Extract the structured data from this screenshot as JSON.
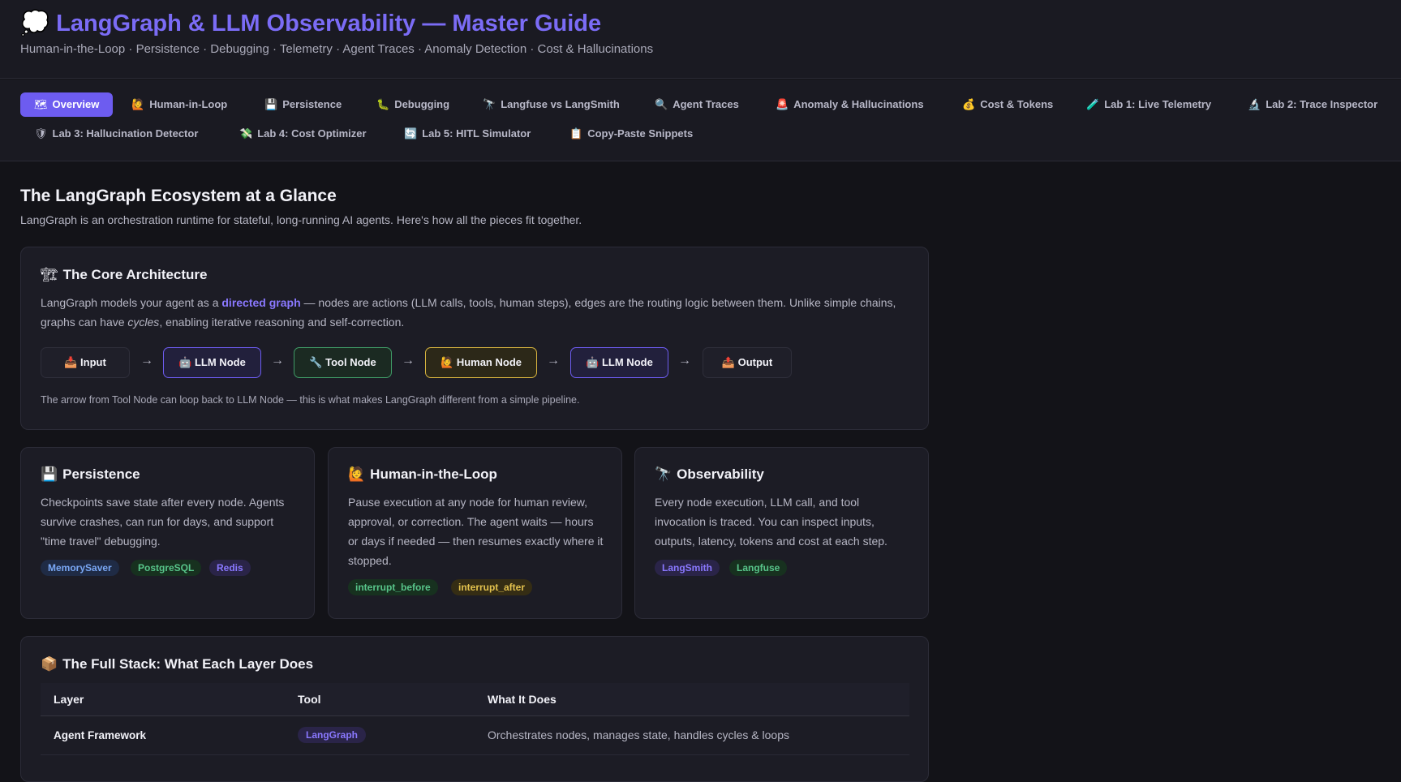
{
  "header": {
    "icon": "💭",
    "title": "LangGraph & LLM Observability — Master Guide",
    "subtitle": "Human-in-the-Loop · Persistence · Debugging · Telemetry · Agent Traces · Anomaly Detection · Cost & Hallucinations"
  },
  "tabs": [
    {
      "icon": "🗺",
      "label": "Overview",
      "active": true
    },
    {
      "icon": "🙋",
      "label": "Human-in-Loop"
    },
    {
      "icon": "💾",
      "label": "Persistence"
    },
    {
      "icon": "🐛",
      "label": "Debugging"
    },
    {
      "icon": "🔭",
      "label": "Langfuse vs LangSmith"
    },
    {
      "icon": "🔍",
      "label": "Agent Traces"
    },
    {
      "icon": "🚨",
      "label": "Anomaly & Hallucinations"
    },
    {
      "icon": "💰",
      "label": "Cost & Tokens"
    },
    {
      "icon": "🧪",
      "label": "Lab 1: Live Telemetry"
    },
    {
      "icon": "🔬",
      "label": "Lab 2: Trace Inspector"
    },
    {
      "icon": "🛡",
      "label": "Lab 3: Hallucination Detector"
    },
    {
      "icon": "💸",
      "label": "Lab 4: Cost Optimizer"
    },
    {
      "icon": "🔄",
      "label": "Lab 5: HITL Simulator"
    },
    {
      "icon": "📋",
      "label": "Copy-Paste Snippets"
    }
  ],
  "main": {
    "title": "The LangGraph Ecosystem at a Glance",
    "description": "LangGraph is an orchestration runtime for stateful, long-running AI agents. Here's how all the pieces fit together."
  },
  "core": {
    "icon": "🏗",
    "title": "The Core Architecture",
    "text_before": "LangGraph models your agent as a ",
    "highlight": "directed graph",
    "text_after": " — nodes are actions (LLM calls, tools, human steps), edges are the routing logic between them. Unlike simple chains, graphs can have ",
    "emph": "cycles",
    "text_end": ", enabling iterative reasoning and self-correction.",
    "nodes": [
      {
        "icon": "📥",
        "label": "Input"
      },
      {
        "icon": "🤖",
        "label": "LLM Node"
      },
      {
        "icon": "🔧",
        "label": "Tool Node"
      },
      {
        "icon": "🙋",
        "label": "Human Node"
      },
      {
        "icon": "🤖",
        "label": "LLM Node"
      },
      {
        "icon": "📤",
        "label": "Output"
      }
    ],
    "arrow": "→",
    "note": "The arrow from Tool Node can loop back to LLM Node — this is what makes LangGraph different from a simple pipeline."
  },
  "cards": [
    {
      "icon": "💾",
      "title": "Persistence",
      "text": "Checkpoints save state after every node. Agents survive crashes, can run for days, and support \"time travel\" debugging.",
      "tags": [
        "MemorySaver",
        "PostgreSQL",
        "Redis"
      ]
    },
    {
      "icon": "🙋",
      "title": "Human-in-the-Loop",
      "text": "Pause execution at any node for human review, approval, or correction. The agent waits — hours or days if needed — then resumes exactly where it stopped.",
      "tags": [
        "interrupt_before",
        "interrupt_after"
      ]
    },
    {
      "icon": "🔭",
      "title": "Observability",
      "text": "Every node execution, LLM call, and tool invocation is traced. You can inspect inputs, outputs, latency, tokens and cost at each step.",
      "tags": [
        "LangSmith",
        "Langfuse"
      ]
    }
  ],
  "stack": {
    "icon": "📦",
    "title": "The Full Stack: What Each Layer Does",
    "columns": [
      "Layer",
      "Tool",
      "What It Does"
    ],
    "rows": [
      {
        "layer": "Agent Framework",
        "tool": "LangGraph",
        "desc": "Orchestrates nodes, manages state, handles cycles & loops"
      }
    ]
  },
  "colors": {
    "accent": "#6d5cf0",
    "title": "#7b6cf6",
    "background": "#131318",
    "card": "#1c1c25"
  }
}
